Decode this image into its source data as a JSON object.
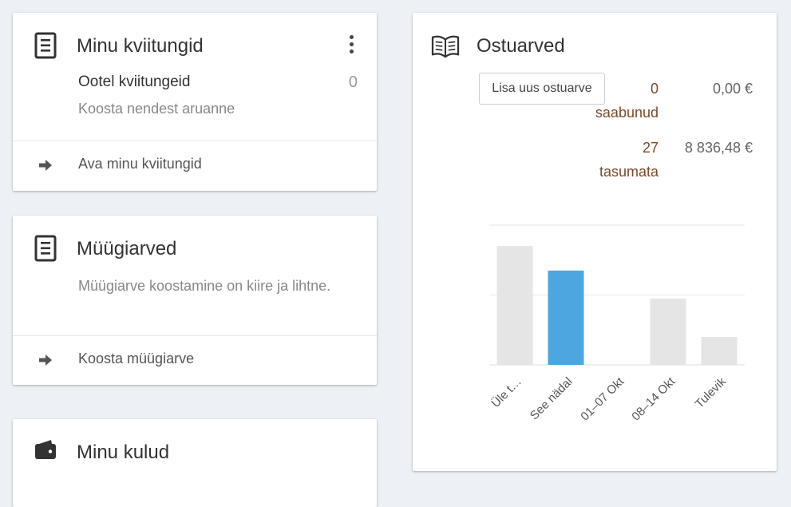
{
  "receipts": {
    "title": "Minu kviitungid",
    "pending_label": "Ootel kviitungeid",
    "pending_count": "0",
    "pending_hint": "Koosta nendest aruanne",
    "action_label": "Ava minu kviitungid",
    "icons": {
      "main": "document-list-icon",
      "menu": "more-vertical-icon",
      "action": "arrow-right-icon"
    }
  },
  "sales": {
    "title": "Müügiarved",
    "description": "Müügiarve koostamine on kiire ja lihtne.",
    "action_label": "Koosta müügiarve",
    "icons": {
      "main": "document-list-icon",
      "action": "arrow-right-icon"
    }
  },
  "expenses": {
    "title": "Minu kulud",
    "icons": {
      "main": "wallet-icon"
    }
  },
  "purchases": {
    "title": "Ostuarved",
    "add_button": "Lisa uus ostuarve",
    "stats": [
      {
        "count": "0",
        "label": "saabunud",
        "amount": "0,00 €"
      },
      {
        "count": "27",
        "label": "tasumata",
        "amount": "8 836,48 €"
      }
    ],
    "icons": {
      "main": "open-book-icon"
    }
  },
  "chart_data": {
    "type": "bar",
    "categories": [
      "Üle t…",
      "See nädal",
      "01–07 Okt",
      "08–14 Okt",
      "Tulevik"
    ],
    "values": [
      3.4,
      2.7,
      0,
      1.9,
      0.8
    ],
    "highlight_index": 1,
    "bar_color": "#e5e5e6",
    "highlight_color": "#4da6e0",
    "ylim": [
      0,
      4
    ],
    "grid": true,
    "title": "",
    "xlabel": "",
    "ylabel": ""
  }
}
